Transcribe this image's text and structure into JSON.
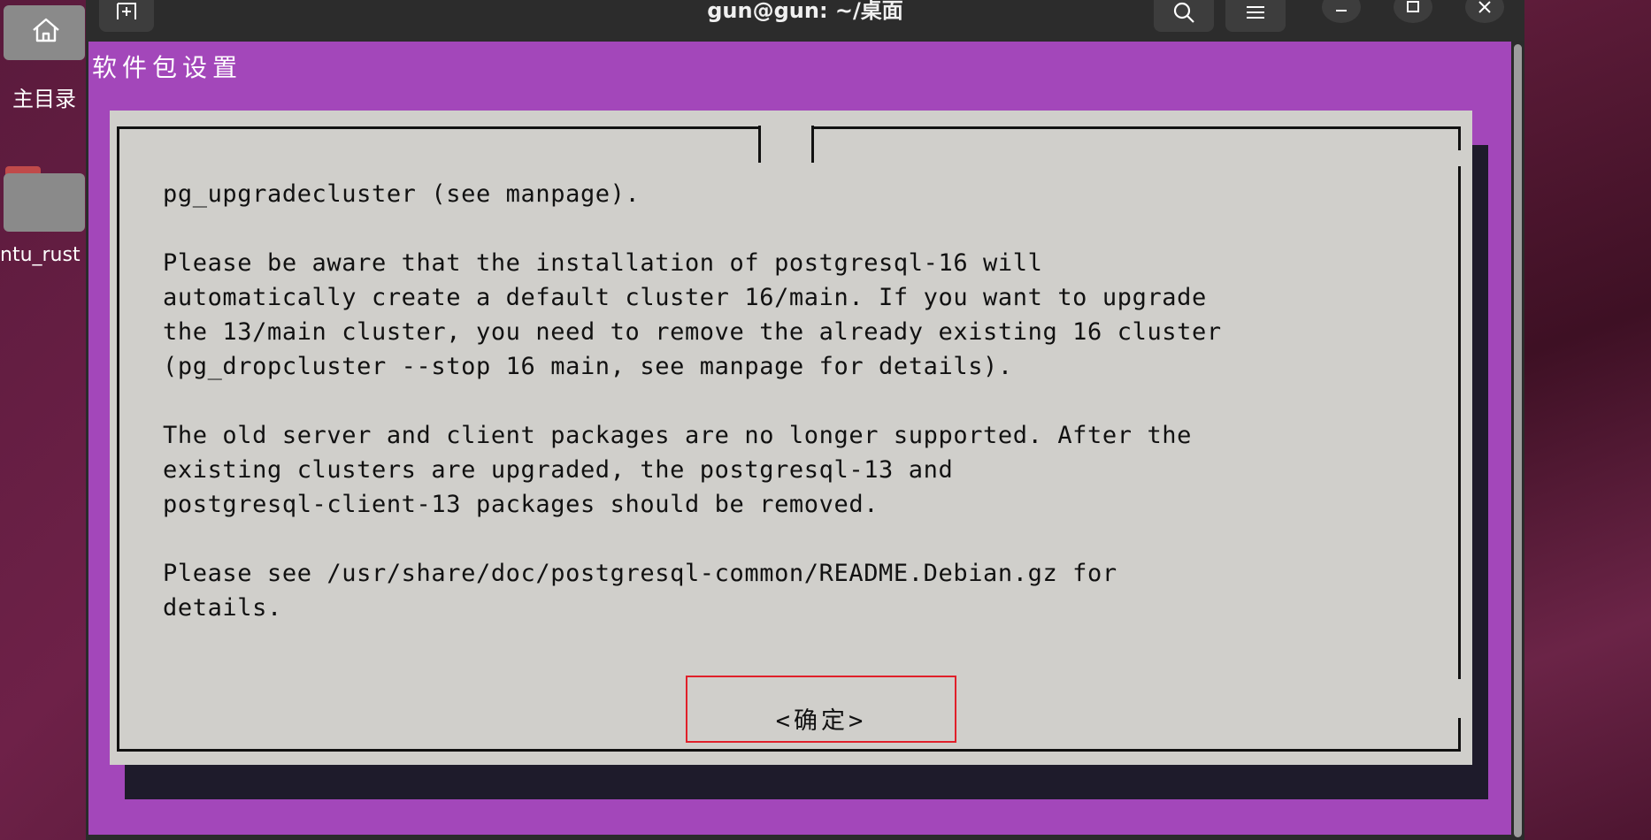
{
  "desktop": {
    "home_label": "主目录",
    "rust_folder_label": "ntu_rust"
  },
  "window": {
    "title": "gun@gun: ~/桌面"
  },
  "terminal": {
    "screen_title": "软件包设置"
  },
  "dialog": {
    "lines": [
      "pg_upgradecluster (see manpage).",
      "",
      "Please be aware that the installation of postgresql-16 will",
      "automatically create a default cluster 16/main. If you want to upgrade",
      "the 13/main cluster, you need to remove the already existing 16 cluster",
      "(pg_dropcluster --stop 16 main, see manpage for details).",
      "",
      "The old server and client packages are no longer supported. After the",
      "existing clusters are upgraded, the postgresql-13 and",
      "postgresql-client-13 packages should be removed.",
      "",
      "Please see /usr/share/doc/postgresql-common/README.Debian.gz for",
      "details."
    ],
    "ok_label": "<确定>"
  },
  "icons": {
    "new_tab": "new-tab-icon",
    "search": "search-icon",
    "menu": "hamburger-menu-icon",
    "minimize": "minimize-icon",
    "maximize": "maximize-icon",
    "close": "close-icon"
  },
  "colors": {
    "terminal_background": "#a347ba",
    "dialog_background": "#d0cfcb",
    "highlight_border": "#e0202a"
  }
}
